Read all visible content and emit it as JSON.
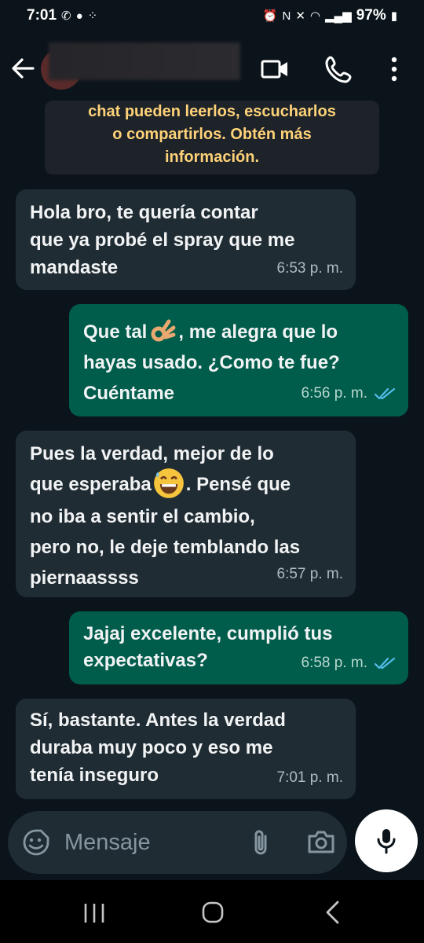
{
  "status_bar": {
    "time": "7:01",
    "battery": "97%"
  },
  "header": {
    "contact_name": "",
    "icons": [
      "back-arrow-icon",
      "video-call-icon",
      "voice-call-icon",
      "more-vert-icon"
    ]
  },
  "notice": {
    "lines": [
      "chat pueden leerlos, escucharlos",
      "o compartirlos. Obtén más",
      "información."
    ]
  },
  "messages": [
    {
      "direction": "in",
      "lines": [
        "Hola bro, te quería contar",
        "que ya probé el spray que me",
        "mandaste"
      ],
      "time": "6:53 p. m."
    },
    {
      "direction": "out",
      "line1_a": "Que tal",
      "line1_b": ", me alegra que lo",
      "lines_rest": [
        "hayas usado. ¿Como te fue?",
        "Cuéntame"
      ],
      "emoji": "ok-hand-emoji",
      "time": "6:56 p. m.",
      "status": "read"
    },
    {
      "direction": "in",
      "line1": "Pues la verdad, mejor de lo",
      "line2_a": "que esperaba",
      "line2_b": ". Pensé que",
      "lines_rest": [
        "no iba a sentir el cambio,",
        "pero no, le deje temblando las",
        "piernaassss"
      ],
      "emoji": "grinning-sweat-emoji",
      "time": "6:57 p. m."
    },
    {
      "direction": "out",
      "lines": [
        "Jajaj excelente, cumplió tus",
        "expectativas?"
      ],
      "time": "6:58 p. m.",
      "status": "read"
    },
    {
      "direction": "in",
      "lines": [
        "Sí, bastante. Antes la verdad",
        "duraba muy poco y eso me",
        "tenía inseguro"
      ],
      "time": "7:01 p. m."
    }
  ],
  "input": {
    "placeholder": "Mensaje"
  },
  "colors": {
    "background": "#0b141a",
    "incoming_bubble": "#202c33",
    "outgoing_bubble": "#005c4b",
    "notice_text": "#ffd279",
    "read_tick": "#53bdeb"
  }
}
